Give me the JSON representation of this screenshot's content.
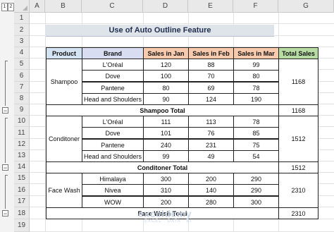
{
  "outline": {
    "levels": [
      "1",
      "2"
    ]
  },
  "columns": [
    "A",
    "B",
    "C",
    "D",
    "E",
    "F",
    "G"
  ],
  "rows": [
    "1",
    "2",
    "3",
    "4",
    "5",
    "6",
    "7",
    "8",
    "9",
    "10",
    "11",
    "12",
    "13",
    "14",
    "15",
    "16",
    "17",
    "18",
    "19"
  ],
  "title": "Use of Auto Outline Feature",
  "table": {
    "headers": [
      "Product",
      "Brand",
      "Sales in Jan",
      "Sales in Feb",
      "Sales in Mar",
      "Total Sales"
    ],
    "groups": [
      {
        "product": "Shampoo",
        "rows": [
          {
            "brand": "L'Oréal",
            "jan": "120",
            "feb": "88",
            "mar": "99"
          },
          {
            "brand": "Dove",
            "jan": "100",
            "feb": "70",
            "mar": "80"
          },
          {
            "brand": "Pantene",
            "jan": "80",
            "feb": "69",
            "mar": "78"
          },
          {
            "brand": "Head and Shoulders",
            "jan": "90",
            "feb": "124",
            "mar": "190"
          }
        ],
        "total": "1168",
        "subtotal_label": "Shampoo Total",
        "subtotal_value": "1168"
      },
      {
        "product": "Conditoner",
        "rows": [
          {
            "brand": "L'Oréal",
            "jan": "111",
            "feb": "113",
            "mar": "78"
          },
          {
            "brand": "Dove",
            "jan": "101",
            "feb": "76",
            "mar": "85"
          },
          {
            "brand": "Pantene",
            "jan": "240",
            "feb": "231",
            "mar": "75"
          },
          {
            "brand": "Head and Shoulders",
            "jan": "99",
            "feb": "49",
            "mar": "54"
          }
        ],
        "total": "1512",
        "subtotal_label": "Conditoner Total",
        "subtotal_value": "1512"
      },
      {
        "product": "Face Wash",
        "rows": [
          {
            "brand": "Himalaya",
            "jan": "300",
            "feb": "200",
            "mar": "290"
          },
          {
            "brand": "Nivea",
            "jan": "310",
            "feb": "140",
            "mar": "290"
          },
          {
            "brand": "WOW",
            "jan": "200",
            "feb": "280",
            "mar": "300"
          }
        ],
        "total": "2310",
        "subtotal_label": "Face Wash Total",
        "subtotal_value": "2310"
      }
    ]
  },
  "watermark": {
    "main": "exceldemy",
    "sub": "EXCEL · DATA · BI"
  },
  "colors": {
    "header_product": "#d4e3f1",
    "header_brand": "#d9ddf1",
    "header_sales": "#f7c9ad",
    "header_total": "#b6dca4"
  }
}
